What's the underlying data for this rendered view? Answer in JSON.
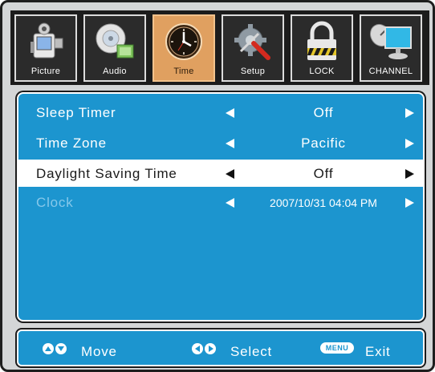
{
  "tabs": [
    {
      "label": "Picture",
      "icon": "camcorder-icon",
      "active": false
    },
    {
      "label": "Audio",
      "icon": "audio-disc-icon",
      "active": false
    },
    {
      "label": "Time",
      "icon": "clock-icon",
      "active": true
    },
    {
      "label": "Setup",
      "icon": "gear-tools-icon",
      "active": false
    },
    {
      "label": "LOCK",
      "icon": "padlock-icon",
      "active": false
    },
    {
      "label": "CHANNEL",
      "icon": "satellite-monitor-icon",
      "active": false
    }
  ],
  "menu": {
    "items": [
      {
        "label": "Sleep Timer",
        "value": "Off",
        "state": "normal"
      },
      {
        "label": "Time Zone",
        "value": "Pacific",
        "state": "normal"
      },
      {
        "label": "Daylight Saving Time",
        "value": "Off",
        "state": "selected"
      },
      {
        "label": "Clock",
        "value": "2007/10/31 04:04 PM",
        "state": "disabled"
      }
    ]
  },
  "hints": {
    "move": "Move",
    "select": "Select",
    "menu_key": "MENU",
    "exit": "Exit"
  },
  "colors": {
    "panel": "#1c95cf",
    "active_tab": "#e0a060",
    "tab_bg": "#2b2b2b",
    "disabled_text": "#86c8ea",
    "selected_row": "#ffffff"
  }
}
